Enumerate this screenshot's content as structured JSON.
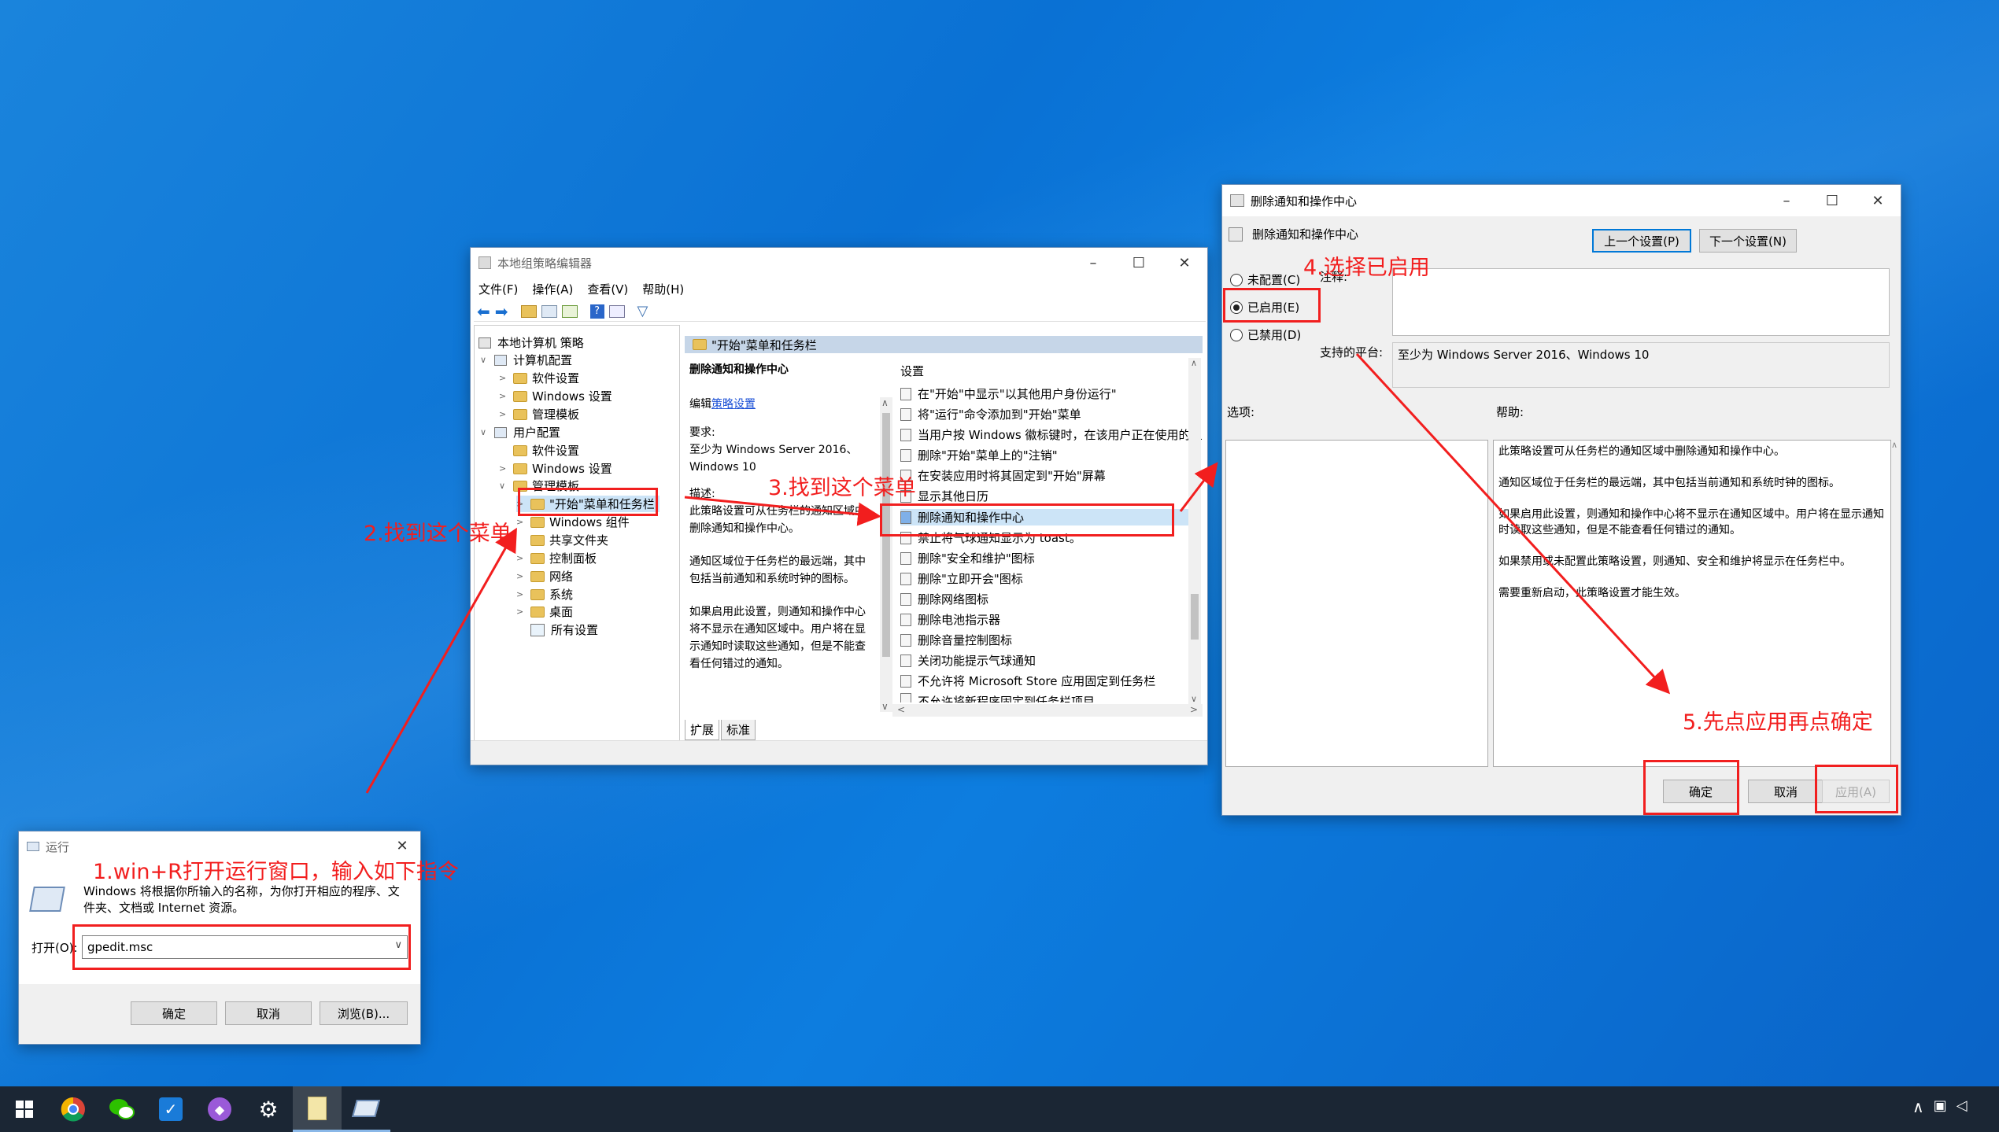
{
  "gp": {
    "title": "本地组策略编辑器",
    "menu": [
      "文件(F)",
      "操作(A)",
      "查看(V)",
      "帮助(H)"
    ],
    "tree": [
      {
        "label": "本地计算机 策略",
        "level": 0
      },
      {
        "label": "计算机配置",
        "level": 1
      },
      {
        "label": "软件设置",
        "level": 2
      },
      {
        "label": "Windows 设置",
        "level": 2
      },
      {
        "label": "管理模板",
        "level": 2
      },
      {
        "label": "用户配置",
        "level": 1
      },
      {
        "label": "软件设置",
        "level": 2
      },
      {
        "label": "Windows 设置",
        "level": 2
      },
      {
        "label": "管理模板",
        "level": 2
      },
      {
        "label": "\"开始\"菜单和任务栏",
        "level": 3
      },
      {
        "label": "Windows 组件",
        "level": 3
      },
      {
        "label": "共享文件夹",
        "level": 3
      },
      {
        "label": "控制面板",
        "level": 3
      },
      {
        "label": "网络",
        "level": 3
      },
      {
        "label": "系统",
        "level": 3
      },
      {
        "label": "桌面",
        "level": 3
      },
      {
        "label": "所有设置",
        "level": 3
      }
    ],
    "header": "\"开始\"菜单和任务栏",
    "desc": {
      "title": "删除通知和操作中心",
      "edit": "编辑",
      "edit_link": "策略设置",
      "req_label": "要求:",
      "req_value": "至少为 Windows Server 2016、Windows 10",
      "desc_label": "描述:",
      "p1": "此策略设置可从任务栏的通知区域中删除通知和操作中心。",
      "p2": "通知区域位于任务栏的最远端，其中包括当前通知和系统时钟的图标。",
      "p3": "如果启用此设置，则通知和操作中心将不显示在通知区域中。用户将在显示通知时读取这些通知，但是不能查看任何错过的通知。"
    },
    "settings_header": "设置",
    "settings": [
      "在\"开始\"中显示\"以其他用户身份运行\"",
      "将\"运行\"命令添加到\"开始\"菜单",
      "当用户按 Windows 徽标键时，在该用户正在使用的显",
      "删除\"开始\"菜单上的\"注销\"",
      "在安装应用时将其固定到\"开始\"屏幕",
      "显示其他日历",
      "删除通知和操作中心",
      "禁止将气球通知显示为 toast。",
      "删除\"安全和维护\"图标",
      "删除\"立即开会\"图标",
      "删除网络图标",
      "删除电池指示器",
      "删除音量控制图标",
      "关闭功能提示气球通知",
      "不允许将 Microsoft Store 应用固定到任务栏",
      "不允许将新程序固定到任务栏项目"
    ],
    "tabs": [
      "扩展",
      "标准"
    ]
  },
  "policy": {
    "title": "删除通知和操作中心",
    "name": "删除通知和操作中心",
    "prev": "上一个设置(P)",
    "next": "下一个设置(N)",
    "opt_notconf": "未配置(C)",
    "opt_enabled": "已启用(E)",
    "opt_disabled": "已禁用(D)",
    "comment_label": "注释:",
    "platform_label": "支持的平台:",
    "platform_value": "至少为 Windows Server 2016、Windows 10",
    "options_label": "选项:",
    "help_label": "帮助:",
    "help": [
      "此策略设置可从任务栏的通知区域中删除通知和操作中心。",
      "通知区域位于任务栏的最远端，其中包括当前通知和系统时钟的图标。",
      "如果启用此设置，则通知和操作中心将不显示在通知区域中。用户将在显示通知时读取这些通知，但是不能查看任何错过的通知。",
      "如果禁用或未配置此策略设置，则通知、安全和维护将显示在任务栏中。",
      "需要重新启动，此策略设置才能生效。"
    ],
    "ok": "确定",
    "cancel": "取消",
    "apply": "应用(A)"
  },
  "run": {
    "title": "运行",
    "desc": "Windows 将根据你所输入的名称，为你打开相应的程序、文件夹、文档或 Internet 资源。",
    "open_label": "打开(O):",
    "input_value": "gpedit.msc",
    "ok": "确定",
    "cancel": "取消",
    "browse": "浏览(B)..."
  },
  "notes": {
    "n1": "1.win+R打开运行窗口，输入如下指令",
    "n2": "2.找到这个菜单",
    "n3": "3.找到这个菜单",
    "n4": "4.选择已启用",
    "n5": "5.先点应用再点确定"
  },
  "taskbar": {
    "apps": [
      "chrome-icon",
      "wechat-icon",
      "todo-icon",
      "cat-icon",
      "settings-icon",
      "notepad-icon",
      "run-icon"
    ]
  },
  "colors": {
    "annotation": "#f21e1e",
    "accent": "#0078d7",
    "taskbar": "#1b2634"
  }
}
